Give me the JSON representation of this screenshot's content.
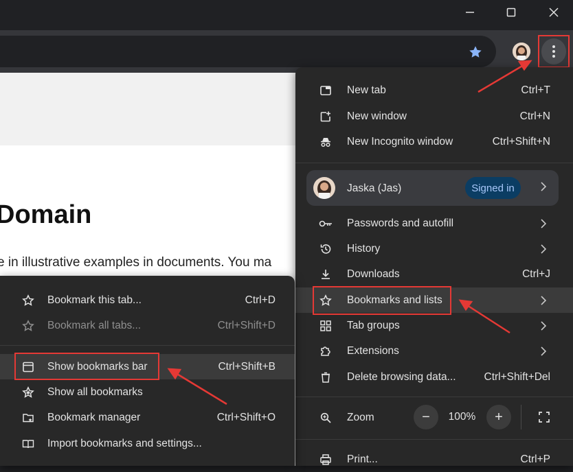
{
  "window": {
    "minimize_icon": "minimize-icon",
    "maximize_icon": "maximize-icon",
    "close_icon": "close-icon"
  },
  "page": {
    "heading": "Domain",
    "body_text": "e in illustrative examples in documents. You ma"
  },
  "main_menu": {
    "items": [
      {
        "label": "New tab",
        "shortcut": "Ctrl+T",
        "icon": "new-tab-icon"
      },
      {
        "label": "New window",
        "shortcut": "Ctrl+N",
        "icon": "new-window-icon"
      },
      {
        "label": "New Incognito window",
        "shortcut": "Ctrl+Shift+N",
        "icon": "incognito-icon"
      }
    ],
    "profile": {
      "name": "Jaska (Jas)",
      "badge": "Signed in"
    },
    "items2": [
      {
        "label": "Passwords and autofill",
        "shortcut": "",
        "icon": "key-icon"
      },
      {
        "label": "History",
        "shortcut": "",
        "icon": "history-icon"
      },
      {
        "label": "Downloads",
        "shortcut": "Ctrl+J",
        "icon": "download-icon"
      },
      {
        "label": "Bookmarks and lists",
        "shortcut": "",
        "icon": "star-icon"
      },
      {
        "label": "Tab groups",
        "shortcut": "",
        "icon": "tab-groups-icon"
      },
      {
        "label": "Extensions",
        "shortcut": "",
        "icon": "extensions-icon"
      },
      {
        "label": "Delete browsing data...",
        "shortcut": "Ctrl+Shift+Del",
        "icon": "trash-icon"
      }
    ],
    "zoom": {
      "label": "Zoom",
      "value": "100%",
      "minus": "−",
      "plus": "+"
    },
    "print": {
      "label": "Print...",
      "shortcut": "Ctrl+P"
    }
  },
  "bookmarks_menu": {
    "items": [
      {
        "label": "Bookmark this tab...",
        "shortcut": "Ctrl+D",
        "disabled": false
      },
      {
        "label": "Bookmark all tabs...",
        "shortcut": "Ctrl+Shift+D",
        "disabled": true
      },
      {
        "label": "Show bookmarks bar",
        "shortcut": "Ctrl+Shift+B",
        "disabled": false
      },
      {
        "label": "Show all bookmarks",
        "shortcut": "",
        "disabled": false
      },
      {
        "label": "Bookmark manager",
        "shortcut": "Ctrl+Shift+O",
        "disabled": false
      },
      {
        "label": "Import bookmarks and settings...",
        "shortcut": "",
        "disabled": false
      }
    ]
  },
  "colors": {
    "annotation": "#e53935",
    "badge_bg": "#0b3d63",
    "badge_text": "#a8c7fa",
    "menu_bg": "#282828"
  }
}
